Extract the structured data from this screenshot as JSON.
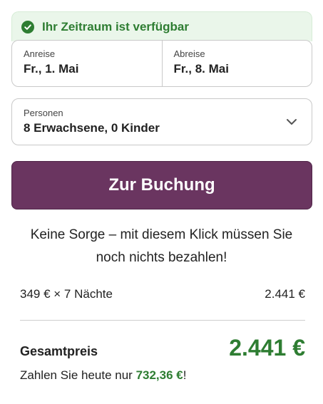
{
  "availability": {
    "text": "Ihr Zeitraum ist verfügbar"
  },
  "dates": {
    "arrival": {
      "label": "Anreise",
      "value": "Fr., 1. Mai"
    },
    "departure": {
      "label": "Abreise",
      "value": "Fr., 8. Mai"
    }
  },
  "persons": {
    "label": "Personen",
    "value": "8 Erwachsene, 0 Kinder"
  },
  "booking": {
    "button_label": "Zur Buchung"
  },
  "note": {
    "line1": "Keine Sorge – mit diesem Klick müssen Sie",
    "line2": "noch nichts bezahlen!"
  },
  "price": {
    "line_label": "349 € × 7 Nächte",
    "line_value": "2.441 €",
    "total_label": "Gesamtpreis",
    "total_value": "2.441 €",
    "today_prefix": "Zahlen Sie heute nur ",
    "today_amount": "732,36 €",
    "today_suffix": "!"
  },
  "colors": {
    "accent_green": "#2e7d32",
    "button_purple": "#6a3560"
  },
  "icons": {
    "availability": "check-circle-icon",
    "persons_dropdown": "chevron-down-icon"
  }
}
